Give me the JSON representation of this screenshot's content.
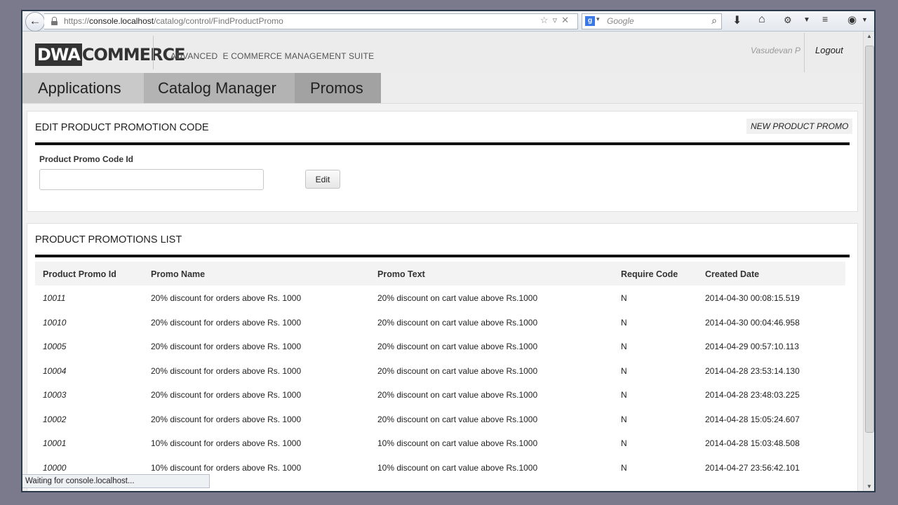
{
  "browser": {
    "url_prefix": "https://",
    "url_host": "console.localhost",
    "url_path": "/catalog/control/FindProductPromo",
    "search_placeholder": "Google",
    "search_engine_letter": "g",
    "status_text": "Waiting for console.localhost...",
    "icons": [
      "back-arrow-icon",
      "lock-icon",
      "bookmark-star-icon",
      "dropdown-icon",
      "stop-icon",
      "google-search-icon",
      "magnifier-icon",
      "download-icon",
      "home-icon",
      "addon-icon",
      "menu-dropdown-icon",
      "toolbar-icon",
      "profile-icon"
    ]
  },
  "header": {
    "logo_left": "DWA",
    "logo_right": "COMMERCE",
    "suite_title": "ADVANCED  E COMMERCE MANAGEMENT SUITE",
    "user_name": "Vasudevan P",
    "logout_label": "Logout"
  },
  "nav": {
    "tabs": [
      {
        "label": "Applications"
      },
      {
        "label": "Catalog Manager"
      },
      {
        "label": "Promos"
      }
    ]
  },
  "edit_panel": {
    "title": "EDIT PRODUCT PROMOTION CODE",
    "new_promo_label": "NEW PRODUCT PROMO",
    "field_label": "Product Promo Code Id",
    "field_value": "",
    "edit_label": "Edit"
  },
  "list_panel": {
    "title": "PRODUCT PROMOTIONS LIST",
    "columns": [
      "Product Promo Id",
      "Promo Name",
      "Promo Text",
      "Require Code",
      "Created Date"
    ],
    "rows": [
      [
        "10011",
        "20% discount for orders above Rs. 1000",
        "20% discount on cart value above Rs.1000",
        "N",
        "2014-04-30 00:08:15.519"
      ],
      [
        "10010",
        "20% discount for orders above Rs. 1000",
        "20% discount on cart value above Rs.1000",
        "N",
        "2014-04-30 00:04:46.958"
      ],
      [
        "10005",
        "20% discount for orders above Rs. 1000",
        "20% discount on cart value above Rs.1000",
        "N",
        "2014-04-29 00:57:10.113"
      ],
      [
        "10004",
        "20% discount for orders above Rs. 1000",
        "20% discount on cart value above Rs.1000",
        "N",
        "2014-04-28 23:53:14.130"
      ],
      [
        "10003",
        "20% discount for orders above Rs. 1000",
        "20% discount on cart value above Rs.1000",
        "N",
        "2014-04-28 23:48:03.225"
      ],
      [
        "10002",
        "20% discount for orders above Rs. 1000",
        "20% discount on cart value above Rs.1000",
        "N",
        "2014-04-28 15:05:24.607"
      ],
      [
        "10001",
        "10% discount for orders above Rs. 1000",
        "10% discount on cart value above Rs.1000",
        "N",
        "2014-04-28 15:03:48.508"
      ],
      [
        "10000",
        "10% discount for orders above Rs. 1000",
        "10% discount on cart value above Rs.1000",
        "N",
        "2014-04-27 23:56:42.101"
      ]
    ]
  }
}
